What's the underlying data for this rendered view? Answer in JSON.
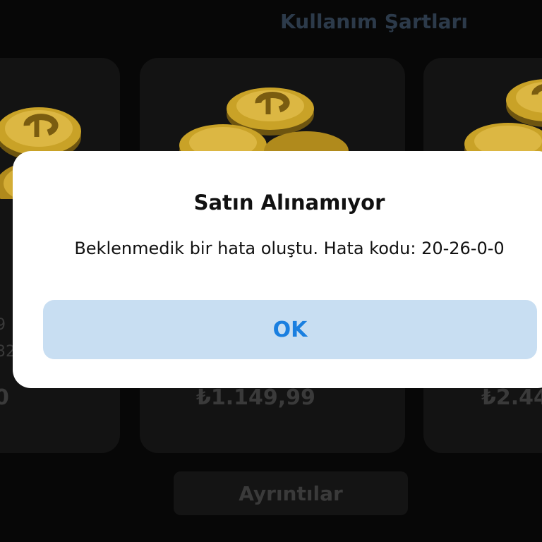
{
  "header": {
    "terms_label": "Kullanım Şartları"
  },
  "cards": {
    "left": {
      "price": "0",
      "line1": "9",
      "line2": "32"
    },
    "mid": {
      "price": "₺1.149,99"
    },
    "right": {
      "price": "₺2.44"
    }
  },
  "details_button": {
    "label": "Ayrıntılar"
  },
  "dialog": {
    "title": "Satın Alınamıyor",
    "message": "Beklenmedik bir hata oluştu. Hata kodu: 20-26-0-0",
    "ok_label": "OK"
  },
  "colors": {
    "accent": "#1a7fe0",
    "ok_button_bg": "#c8def2",
    "coin": "#c9a227"
  },
  "icons": {
    "coin": "coin-stack-icon"
  }
}
